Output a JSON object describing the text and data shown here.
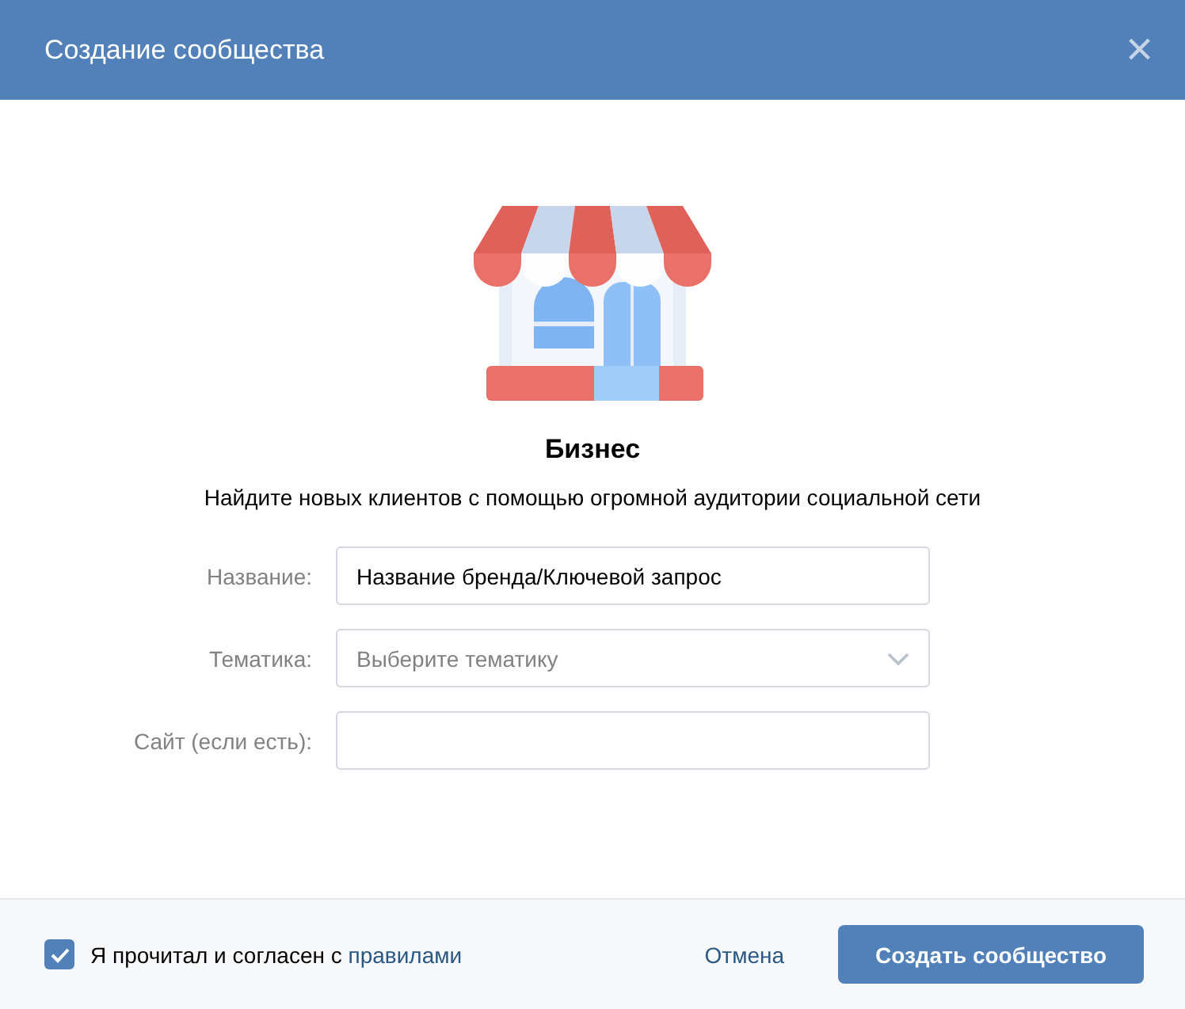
{
  "window": {
    "title": "Создание сообщества",
    "close": "×"
  },
  "hero": {
    "title": "Бизнес",
    "description": "Найдите новых клиентов с помощью огромной аудитории социальной сети"
  },
  "fields": [
    {
      "kind": "text",
      "label": "Название:",
      "value": "Название бренда/Ключевой запрос"
    },
    {
      "kind": "select",
      "label": "Тематика:",
      "placeholder": "Выберите тематику"
    },
    {
      "kind": "text",
      "label": "Сайт (если есть):"
    }
  ],
  "footer": {
    "agreement": {
      "text": "Я прочитал и согласен с",
      "link": "правилами",
      "checked": true
    },
    "cancel": "Отмена",
    "submit": "Создать сообщество"
  }
}
